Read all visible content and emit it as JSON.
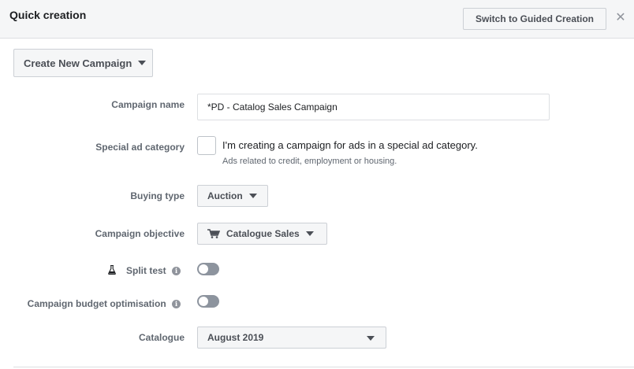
{
  "header": {
    "title": "Quick creation",
    "guided_button": "Switch to Guided Creation",
    "close_icon": "close-icon"
  },
  "create_button": {
    "label": "Create New Campaign"
  },
  "form": {
    "campaign_name": {
      "label": "Campaign name",
      "value": "*PD - Catalog Sales Campaign"
    },
    "special_ad_category": {
      "label": "Special ad category",
      "checkbox_text": "I'm creating a campaign for ads in a special ad category.",
      "subtext": "Ads related to credit, employment or housing.",
      "checked": false
    },
    "buying_type": {
      "label": "Buying type",
      "value": "Auction"
    },
    "campaign_objective": {
      "label": "Campaign objective",
      "value": "Catalogue Sales",
      "icon": "cart-icon"
    },
    "split_test": {
      "label": "Split test",
      "icon": "flask-icon",
      "enabled": false
    },
    "budget_optimisation": {
      "label": "Campaign budget optimisation",
      "enabled": false
    },
    "catalogue": {
      "label": "Catalogue",
      "value": "August 2019"
    }
  }
}
